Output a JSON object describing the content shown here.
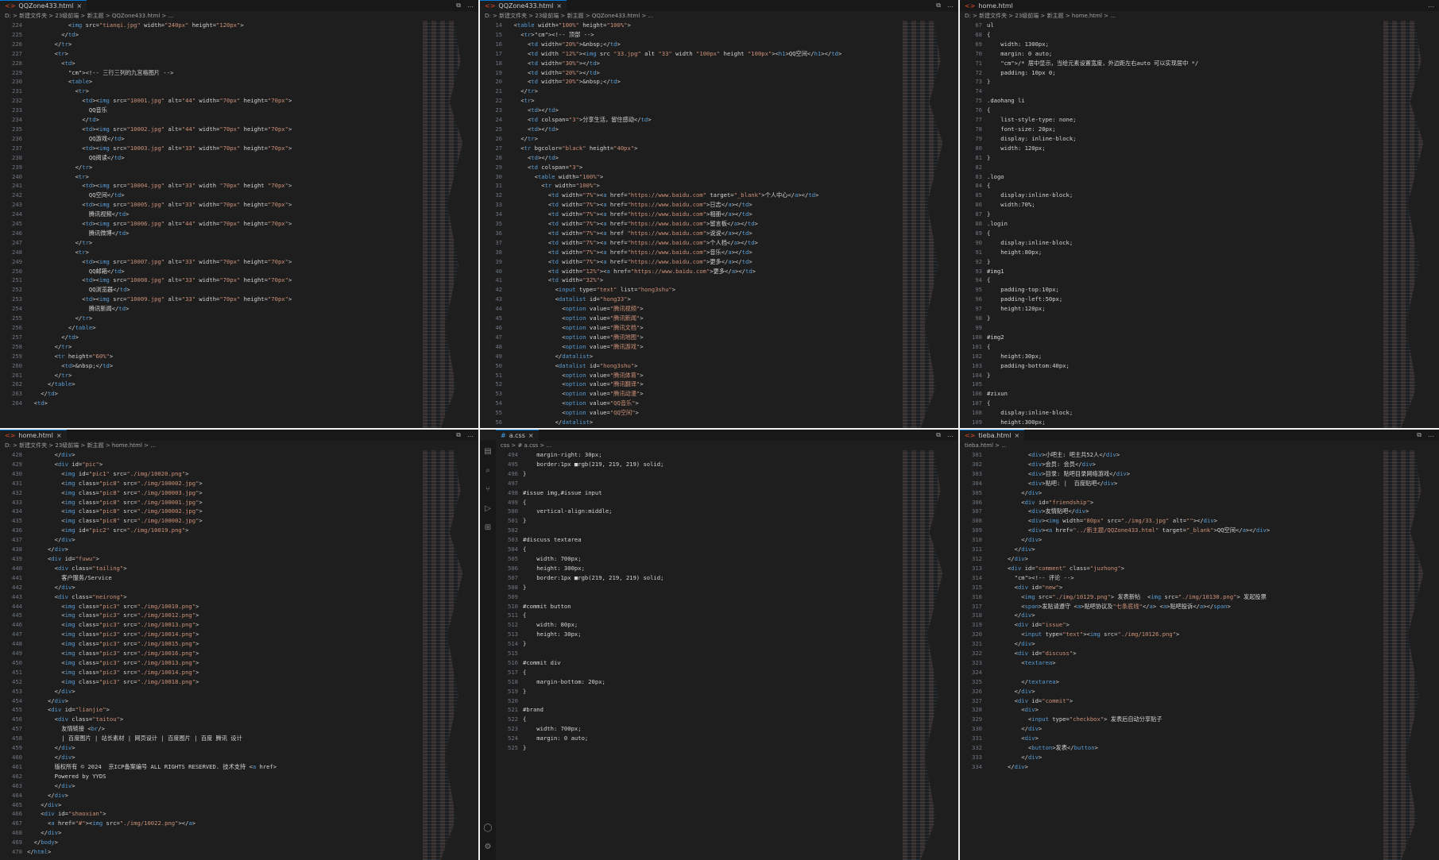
{
  "panes": [
    {
      "tab": "QQZone433.html",
      "crumb": "D: > 新建文件夹 > 23级前端 > 新主题 > QQZone433.html > ...",
      "line_start": 224,
      "lines": [
        "            <img src=\"tianqi.jpg\" width=\"240px\" height=\"120px\">",
        "          </td>",
        "        </tr>",
        "        <tr>",
        "          <td>",
        "            <!-- 三行三列的九宫格图片 -->",
        "            <table>",
        "              <tr>",
        "                <td><img src=\"10001.jpg\" alt=\"44\" width=\"70px\" height=\"70px\">",
        "                  QQ音乐",
        "                </td>",
        "                <td><img src=\"10002.jpg\" alt=\"44\" width=\"70px\" height=\"70px\">",
        "                  QQ游戏</td>",
        "                <td><img src=\"10003.jpg\" alt=\"33\" width=\"70px\" height=\"70px\">",
        "                  QQ阅读</td>",
        "              </tr>",
        "              <tr>",
        "                <td><img src=\"10004.jpg\" alt=\"33\" width \"70px\" height \"70px\">",
        "                  QQ空间</td>",
        "                <td><img src=\"10005.jpg\" alt=\"33\" width=\"70px\" height=\"70px\">",
        "                  腾讯视频</td>",
        "                <td><img src=\"10006.jpg\" alt=\"44\" width=\"70px\" height=\"70px\">",
        "                  腾讯微博</td>",
        "              </tr>",
        "              <tr>",
        "                <td><img src=\"10007.jpg\" alt=\"33\" width=\"70px\" height=\"70px\">",
        "                  QQ邮箱</td>",
        "                <td><img src=\"10008.jpg\" alt=\"33\" width=\"70px\" height=\"70px\">",
        "                  QQ浏览器</td>",
        "                <td><img src=\"10009.jpg\" alt=\"33\" width=\"70px\" height=\"70px\">",
        "                  腾讯新闻</td>",
        "              </tr>",
        "            </table>",
        "          </td>",
        "        </tr>",
        "        <tr height=\"60%\">",
        "          <td>&nbsp;</td>",
        "        </tr>",
        "      </table>",
        "    </td>",
        "  <td>"
      ]
    },
    {
      "tab": "QQZone433.html",
      "crumb": "D: > 新建文件夹 > 23级前端 > 新主题 > QQZone433.html > ...",
      "line_start": 14,
      "lines": [
        "  <table width=\"100%\" height=\"100%\">",
        "    <tr><!-- 顶部 -->",
        "      <td width=\"20%\">&nbsp;</td>",
        "      <td width \"12%\"><img src \"33.jpg\" alt \"33\" width \"100px\" height \"100px\"><h1>QQ空间</h1></td>",
        "      <td width=\"30%\"></td>",
        "      <td width=\"20%\"></td>",
        "      <td width=\"20%\">&nbsp;</td>",
        "    </tr>",
        "    <tr>",
        "      <td></td>",
        "      <td colspan=\"3\">分享生活，留住感动</td>",
        "      <td></td>",
        "    </tr>",
        "    <tr bgcolor=\"black\" height=\"40px\">",
        "      <td></td>",
        "      <td colspan=\"3\">",
        "        <table width=\"100%\">",
        "          <tr width=\"100%\">",
        "            <td width=\"7%\"><a href=\"https://www.baidu.com\" target=\"_blank\">个人中心</a></td>",
        "            <td width=\"7%\"><a href=\"https://www.baidu.com\">日志</a></td>",
        "            <td width=\"7%\"><a href=\"https://www.baidu.com\">相册</a></td>",
        "            <td width=\"7%\"><a href=\"https://www.baidu.com\">留言板</a></td>",
        "            <td width=\"7%\"><a href \"https://www.baidu.com\">说说</a></td>",
        "            <td width=\"7%\"><a href=\"https://www.baidu.com\">个人档</a></td>",
        "            <td width=\"7%\"><a href=\"https://www.baidu.com\">音乐</a></td>",
        "            <td width=\"7%\"><a href=\"https://www.baidu.com\">更多</a></td>",
        "            <td width=\"12%\"><a href=\"https://www.baidu.com\">更多</a></td>",
        "            <td width=\"32%\">",
        "              <input type=\"text\" list=\"hong3shu\">",
        "              <datalist id=\"hong33\">",
        "                <option value=\"腾讯视频\">",
        "                <option value=\"腾讯新闻\">",
        "                <option value=\"腾讯文档\">",
        "                <option value=\"腾讯地图\">",
        "                <option value=\"腾讯游戏\">",
        "              </datalist>",
        "              <datalist id=\"hong3shu\">",
        "                <option value=\"腾讯体育\">",
        "                <option value=\"腾讯翻译\">",
        "                <option value=\"腾讯动漫\">",
        "                <option value=\"QQ音乐\">",
        "                <option value=\"QQ空间\">",
        "              </datalist>"
      ]
    },
    {
      "tab": "home.html",
      "crumb": "D: > 新建文件夹 > 23级前端 > 新主题 > home.html > ...",
      "line_start": 67,
      "lines": [
        "ul",
        "{",
        "    width: 1300px;",
        "    margin: 0 auto;",
        "    /* 居中显示，当给元素设置宽度，外边距左右auto 可以实现居中 */",
        "    padding: 10px 0;",
        "}",
        "",
        ".daohang li",
        "{",
        "    list-style-type: none;",
        "    font-size: 20px;",
        "    display: inline-block;",
        "    width: 120px;",
        "}",
        "",
        ".logo",
        "{",
        "    display:inline-block;",
        "    width:70%;",
        "}",
        ".login",
        "{",
        "    display:inline-block;",
        "    height:80px;",
        "}",
        "#img1",
        "{",
        "    padding-top:10px;",
        "    padding-left:50px;",
        "    height:120px;",
        "}",
        "",
        "#img2",
        "{",
        "    height:30px;",
        "    padding-bottom:40px;",
        "}",
        "",
        "#zixun",
        "{",
        "    display:inline-block;",
        "    height:300px;"
      ]
    },
    {
      "tab": "home.html",
      "crumb": "D: > 新建文件夹 > 23级前端 > 新主题 > home.html > ...",
      "line_start": 428,
      "lines": [
        "        </div>",
        "        <div id=\"pic\">",
        "          <img id=\"pic1\" src=\"./img/10020.png\">",
        "          <img class=\"pic8\" src=\"./img/100002.jpg\">",
        "          <img class=\"pic8\" src=\"./img/100003.jpg\">",
        "          <img class=\"pic8\" src=\"./img/100001.jpg\">",
        "          <img class=\"pic8\" src=\"./img/100002.jpg\">",
        "          <img class=\"pic8\" src=\"./img/100002.jpg\">",
        "          <img id=\"pic2\" src=\"./img/10019.png\">",
        "        </div>",
        "      </div>",
        "      <div id=\"fuwu\">",
        "        <div class=\"tailing\">",
        "          客户服务/Service",
        "        </div>",
        "        <div class=\"neirong\">",
        "          <img class=\"pic3\" src=\"./img/10010.png\">",
        "          <img class=\"pic3\" src=\"./img/10012.png\">",
        "          <img class=\"pic3\" src=\"./img/10013.png\">",
        "          <img class=\"pic3\" src=\"./img/10014.png\">",
        "          <img class=\"pic3\" src=\"./img/10015.png\">",
        "          <img class=\"pic3\" src=\"./img/10016.png\">",
        "          <img class=\"pic3\" src=\"./img/10013.png\">",
        "          <img class=\"pic3\" src=\"./img/10014.png\">",
        "          <img class=\"pic3\" src=\"./img/10018.png\">",
        "        </div>",
        "      </div>",
        "      <div id=\"lianjie\">",
        "        <div class=\"taitou\">",
        "          友情链接 <br/>",
        "          | 百度图片 | 站长素材 | 网页设计 | 百度图片 | 百度 腾讯 设计",
        "        </div>",
        "        </div>",
        "        版权所有 © 2024  京ICP备案编号 ALL RIGHTS RESERVED. 技术支持 <a href>",
        "        Powered by YYDS",
        "        </div>",
        "      </div>",
        "    </div>",
        "    <div id=\"shaoxian\">",
        "      <a href=\"#\"><img src=\"./img/10022.png\"></a>",
        "    </div>",
        "  </body>",
        "</html>"
      ]
    },
    {
      "tab": "a.css",
      "crumb": "css > # a.css > ...",
      "line_start": 494,
      "lines": [
        "    margin-right: 30px;",
        "    border:1px ■rgb(219, 219, 219) solid;",
        "}",
        "",
        "#issue img,#issue input",
        "{",
        "    vertical-align:middle;",
        "}",
        "",
        "#discuss textarea",
        "{",
        "    width: 700px;",
        "    height: 300px;",
        "    border:1px ■rgb(219, 219, 219) solid;",
        "}",
        "",
        "#commit button",
        "{",
        "    width: 80px;",
        "    height: 30px;",
        "}",
        "",
        "#commit div",
        "{",
        "    margin-bottom: 20px;",
        "}",
        "",
        "#brand",
        "{",
        "    width: 700px;",
        "    margin: 0 auto;",
        "}"
      ]
    },
    {
      "tab": "tieba.html",
      "crumb": "tieba.html > ...",
      "line_start": 301,
      "lines": [
        "            <div>小吧主: 吧主共52人</div>",
        "            <div>会员: 会员</div>",
        "            <div>目录: 贴吧目录网络游戏</div>",
        "            <div>贴吧: |  百度贴吧</div>",
        "          </div>",
        "          <div id=\"friendship\">",
        "            <div>友情贴吧</div>",
        "            <div><img width=\"80px\" src=\"./img/33.jpg\" alt=\"\"></div>",
        "            <div><a href=\"../新主题/QQZone433.html\" target=\"_blank\">QQ空间</a></div>",
        "          </div>",
        "        </div>",
        "      </div>",
        "      <div id=\"comment\" class=\"juzhong\">",
        "        <!-- 评论 -->",
        "        <div id=\"new\">",
        "          <img src=\"./img/10129.png\"> 发表新帖  <img src=\"./img/10130.png\"> 发起投票",
        "          <span>发贴请遵守 <a>贴吧协议及\"七条底线\"</a> <a>贴吧投诉</a></span>",
        "        </div>",
        "        <div id=\"issue\">",
        "          <input type=\"text\"><img src=\"./img/10126.png\">",
        "        </div>",
        "        <div id=\"discuss\">",
        "          <textarea>",
        "",
        "          </textarea>",
        "        </div>",
        "        <div id=\"commit\">",
        "          <div>",
        "            <input type=\"checkbox\"> 发表后自动分享贴子",
        "          </div>",
        "          <div>",
        "            <button>发表</button>",
        "          </div>",
        "      </div>"
      ]
    }
  ],
  "icons": {
    "split": "⧉",
    "more": "…",
    "close": "×"
  }
}
